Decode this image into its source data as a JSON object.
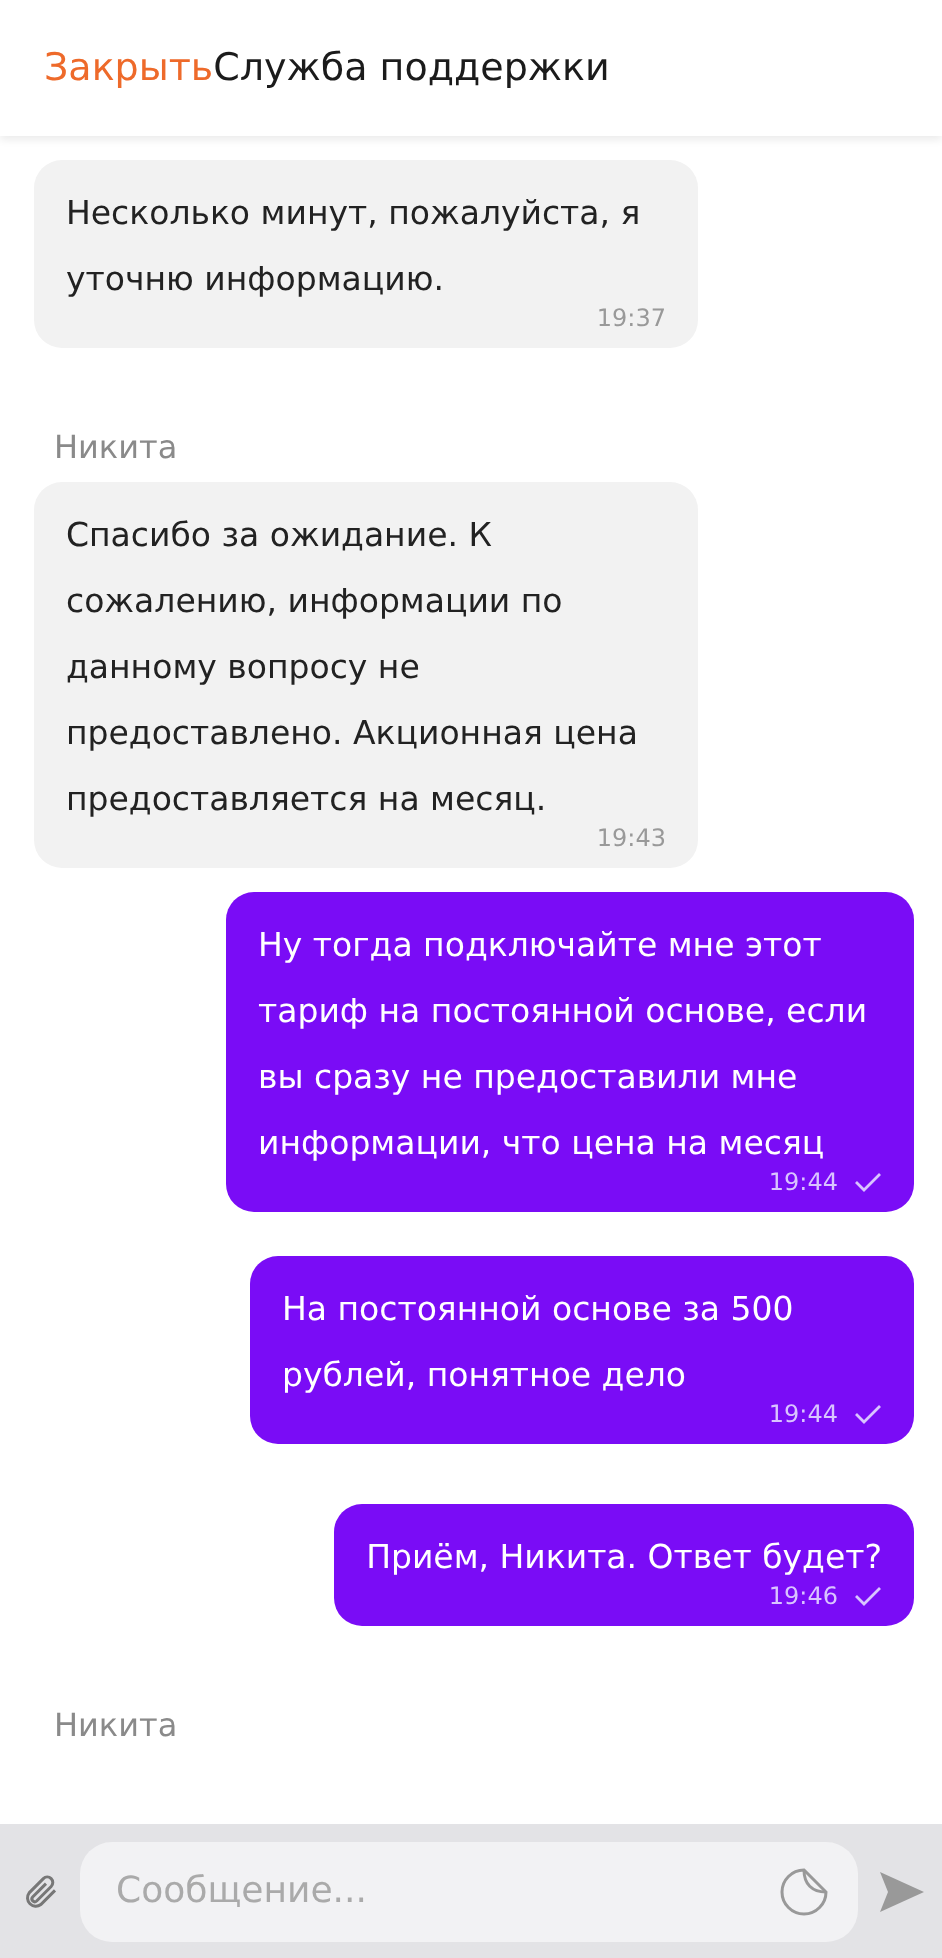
{
  "header": {
    "close_label": "Закрыть",
    "title": "Служба поддержки"
  },
  "messages": [
    {
      "kind": "incoming",
      "text": "Несколько минут, пожалуйста, я уточню информацию.",
      "time": "19:37"
    },
    {
      "kind": "incoming",
      "sender": "Никита",
      "text": "Спасибо за ожидание. К сожалению, информации по данному вопросу не предоставлено. Акционная цена предоставляется на месяц.",
      "time": "19:43"
    },
    {
      "kind": "outgoing",
      "text": "Ну тогда подключайте мне этот тариф на постоянной основе, если вы сразу не предоставили мне информации, что цена на месяц",
      "time": "19:44",
      "read": true
    },
    {
      "kind": "outgoing",
      "text": "На постоянной основе за 500 рублей, понятное дело",
      "time": "19:44",
      "read": true
    },
    {
      "kind": "outgoing",
      "text": "Приём, Никита. Ответ будет?",
      "time": "19:46",
      "read": true
    },
    {
      "kind": "typing",
      "sender": "Никита"
    }
  ],
  "composer": {
    "placeholder": "Сообщение..."
  }
}
